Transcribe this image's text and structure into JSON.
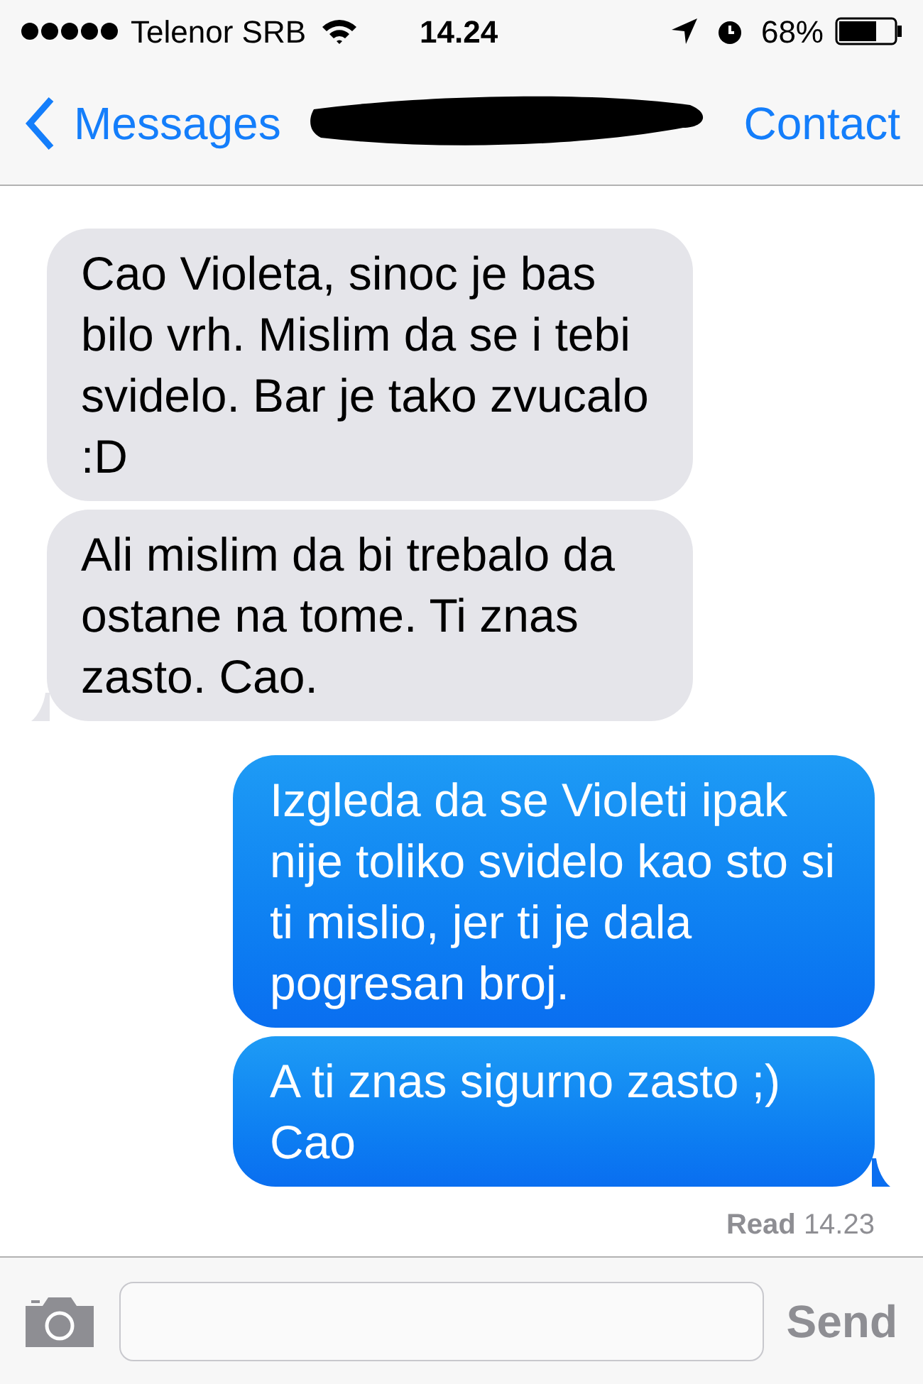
{
  "status_bar": {
    "carrier": "Telenor SRB",
    "time": "14.24",
    "battery": "68%"
  },
  "nav": {
    "back": "Messages",
    "action": "Contact",
    "title_redacted": true
  },
  "messages": [
    {
      "kind": "received",
      "text": "Cao Violeta, sinoc je bas bilo vrh. Mislim da se i tebi svidelo. Bar je tako zvucalo :D",
      "tail": false
    },
    {
      "kind": "received",
      "text": "Ali mislim da bi trebalo da ostane na tome. Ti znas zasto. Cao.",
      "tail": true
    },
    {
      "kind": "sent",
      "text": "Izgleda da se Violeti ipak nije toliko svidelo kao sto si ti mislio, jer ti je dala pogresan broj.",
      "tail": false
    },
    {
      "kind": "sent",
      "text": "A ti znas sigurno zasto ;) Cao",
      "tail": true
    }
  ],
  "receipt": {
    "label": "Read",
    "time": "14.23"
  },
  "composer": {
    "send": "Send",
    "send_disabled": true
  }
}
